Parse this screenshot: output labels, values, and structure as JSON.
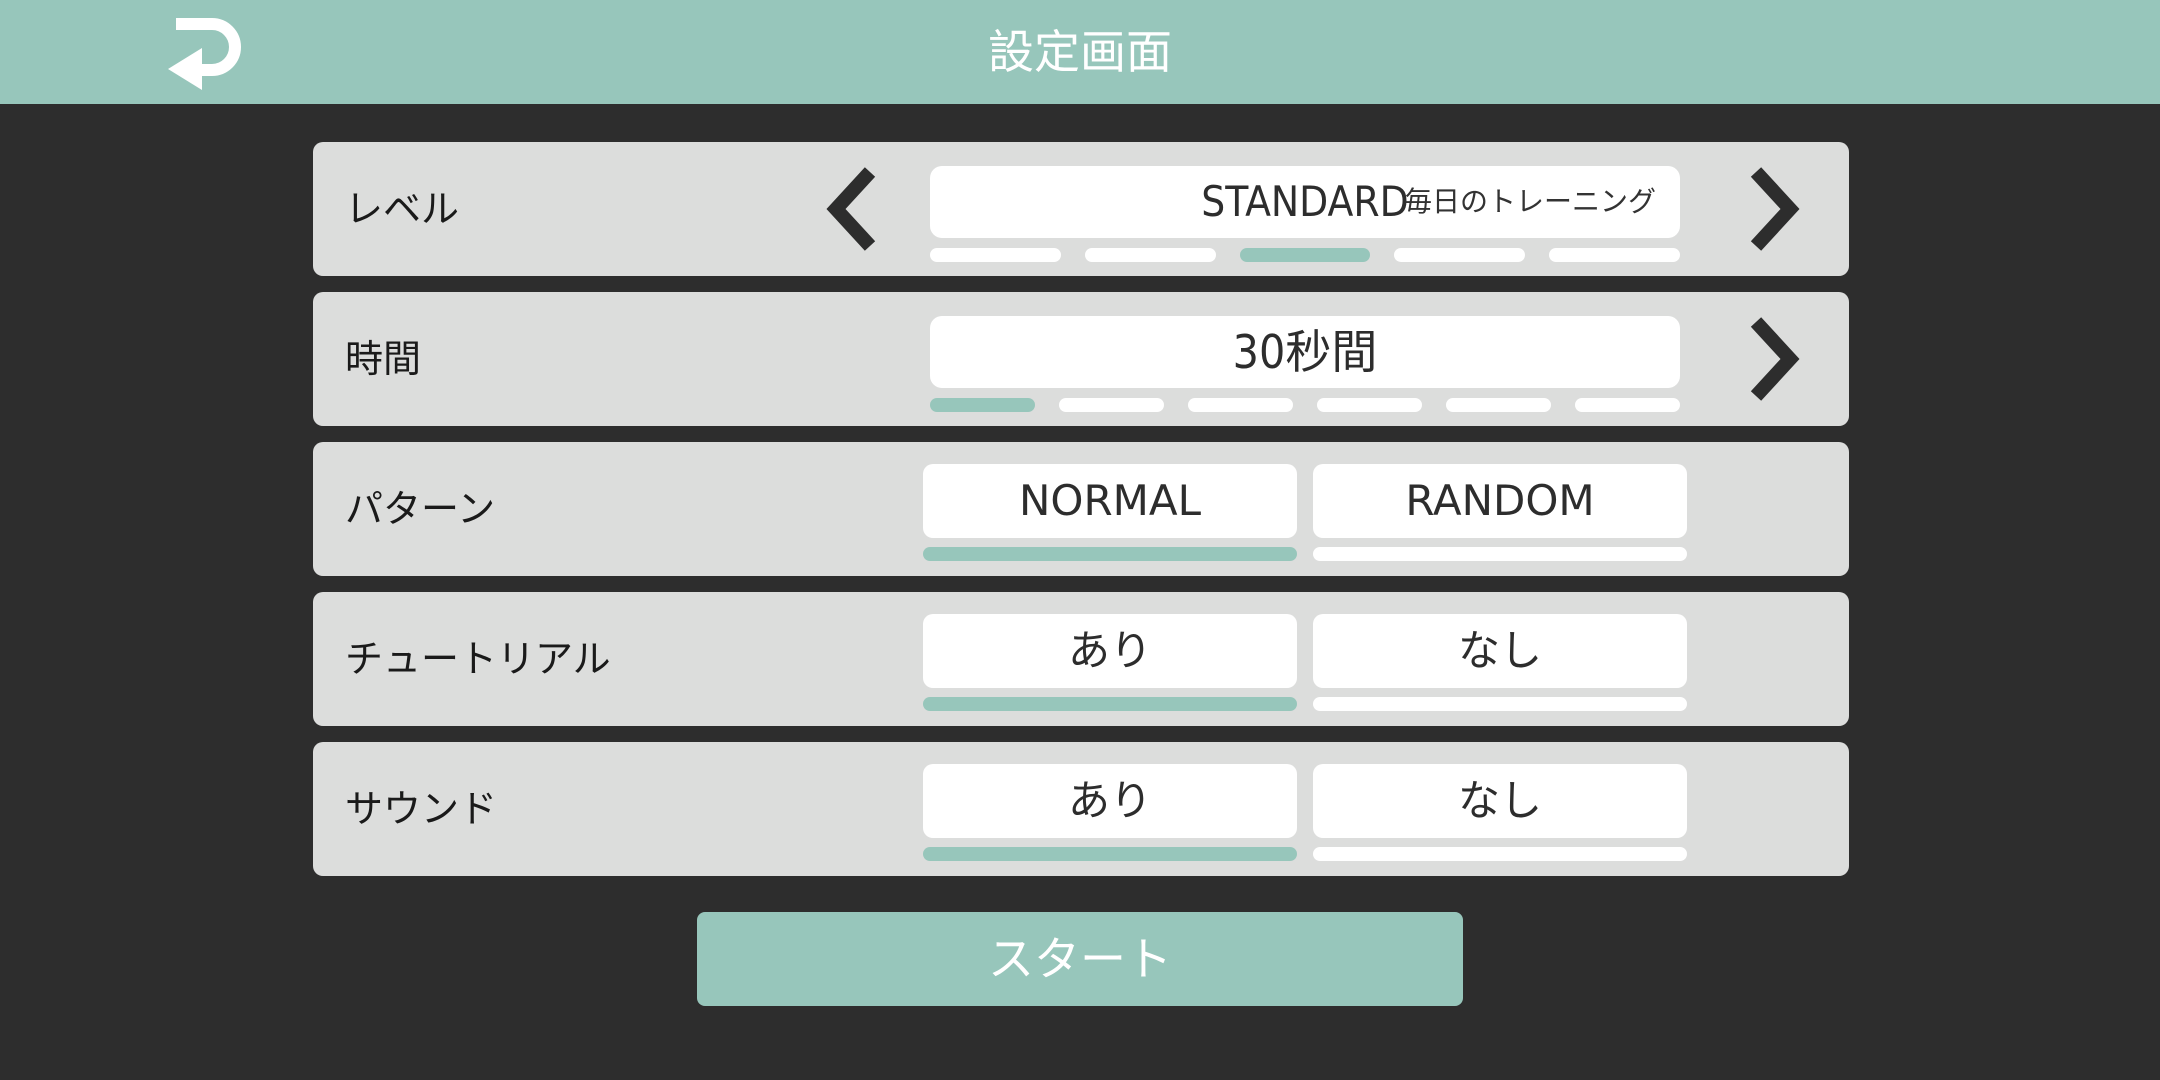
{
  "header": {
    "title": "設定画面",
    "back_icon": "return-arrow-icon"
  },
  "level": {
    "label": "レベル",
    "value": "STANDARD",
    "description": "毎日のトレーニング",
    "selected_index": 2,
    "step_count": 5
  },
  "time": {
    "label": "時間",
    "value": "30秒間",
    "selected_index": 0,
    "step_count": 6
  },
  "pattern": {
    "label": "パターン",
    "options": [
      "NORMAL",
      "RANDOM"
    ],
    "selected": "NORMAL"
  },
  "tutorial": {
    "label": "チュートリアル",
    "options": [
      "あり",
      "なし"
    ],
    "selected": "あり"
  },
  "sound": {
    "label": "サウンド",
    "options": [
      "あり",
      "なし"
    ],
    "selected": "あり"
  },
  "start_label": "スタート",
  "colors": {
    "accent": "#97c6bb",
    "background": "#2d2d2d",
    "panel": "#dcdddc"
  }
}
